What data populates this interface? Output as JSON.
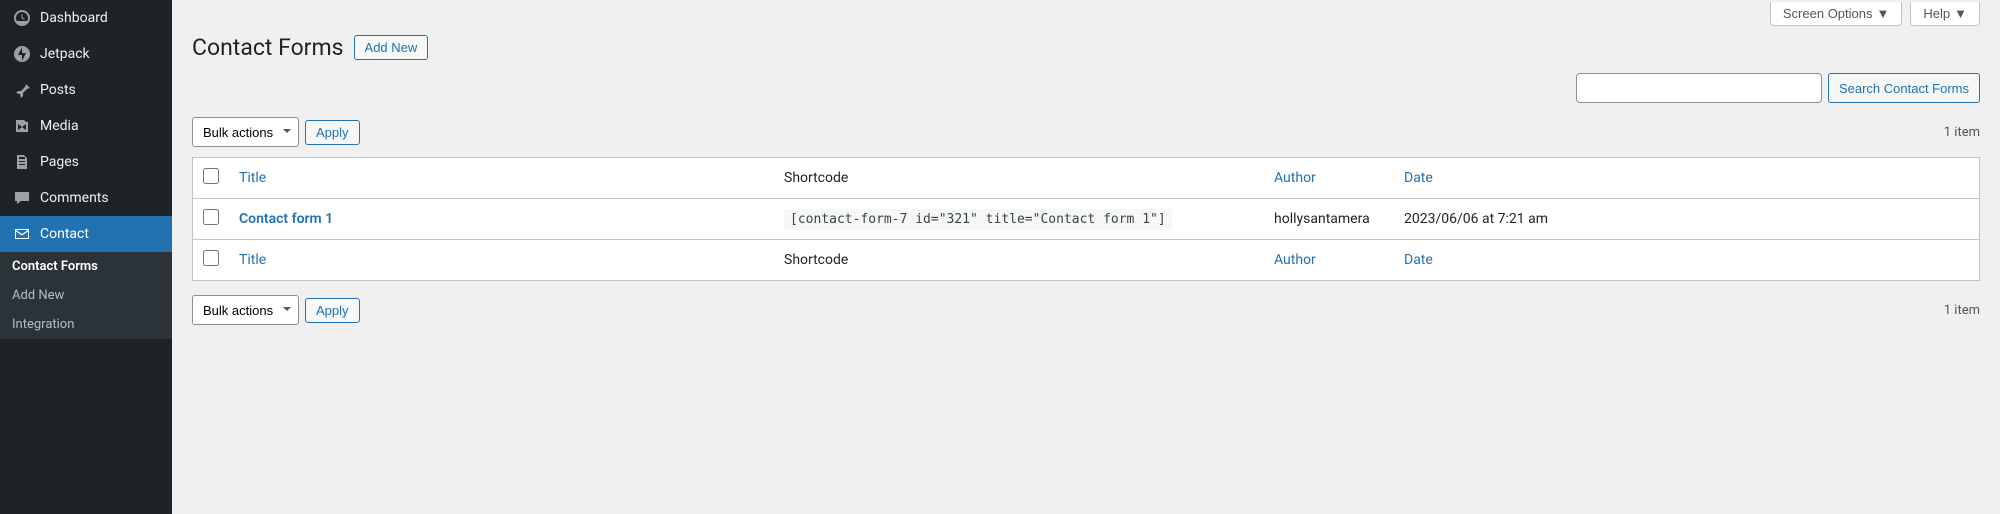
{
  "topbar": {
    "screen_options": "Screen Options",
    "help": "Help"
  },
  "page": {
    "title": "Contact Forms",
    "add_new": "Add New"
  },
  "search": {
    "button": "Search Contact Forms"
  },
  "bulk": {
    "label": "Bulk actions",
    "apply": "Apply"
  },
  "count": "1 item",
  "columns": {
    "title": "Title",
    "shortcode": "Shortcode",
    "author": "Author",
    "date": "Date"
  },
  "rows": [
    {
      "title": "Contact form 1",
      "shortcode": "[contact-form-7 id=\"321\" title=\"Contact form 1\"]",
      "author": "hollysantamera",
      "date": "2023/06/06 at 7:21 am"
    }
  ],
  "sidebar": {
    "items": [
      {
        "label": "Dashboard",
        "icon": "dashboard"
      },
      {
        "label": "Jetpack",
        "icon": "jetpack"
      },
      {
        "label": "Posts",
        "icon": "pin"
      },
      {
        "label": "Media",
        "icon": "media"
      },
      {
        "label": "Pages",
        "icon": "page"
      },
      {
        "label": "Comments",
        "icon": "comment"
      },
      {
        "label": "Contact",
        "icon": "mail",
        "active": true
      }
    ],
    "sub": [
      {
        "label": "Contact Forms",
        "current": true
      },
      {
        "label": "Add New"
      },
      {
        "label": "Integration"
      }
    ]
  }
}
